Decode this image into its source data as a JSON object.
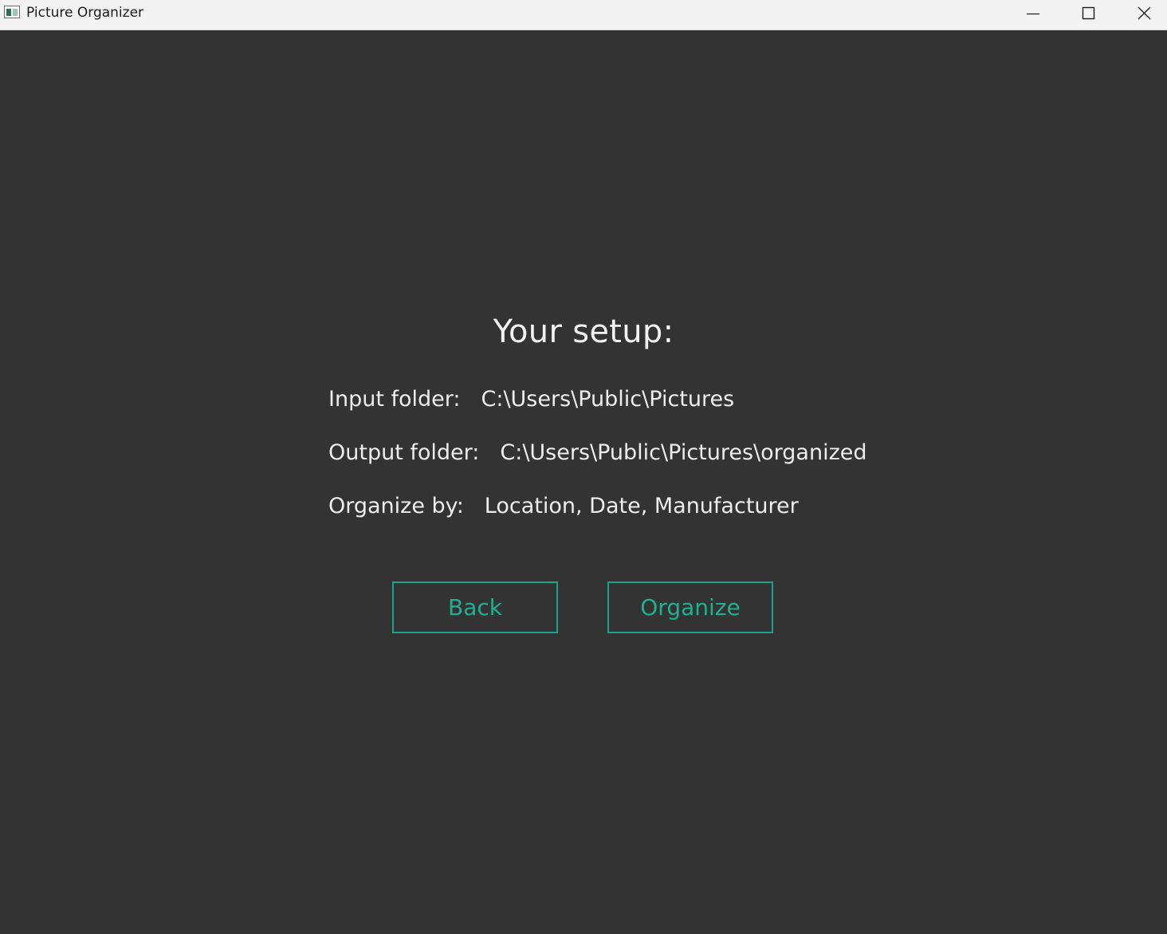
{
  "window": {
    "title": "Picture Organizer",
    "controls": {
      "minimize": "minimize-icon",
      "maximize": "maximize-icon",
      "close": "close-icon"
    }
  },
  "main": {
    "heading": "Your setup:",
    "summary": [
      {
        "label": "Input folder:",
        "value": "C:\\Users\\Public\\Pictures"
      },
      {
        "label": "Output folder:",
        "value": "C:\\Users\\Public\\Pictures\\organized"
      },
      {
        "label": "Organize by:",
        "value": "Location, Date, Manufacturer"
      }
    ],
    "buttons": {
      "back_label": "Back",
      "organize_label": "Organize"
    }
  },
  "colors": {
    "background": "#333333",
    "accent": "#1aa386",
    "text": "#eeeeee",
    "titlebar": "#f3f3f3"
  }
}
